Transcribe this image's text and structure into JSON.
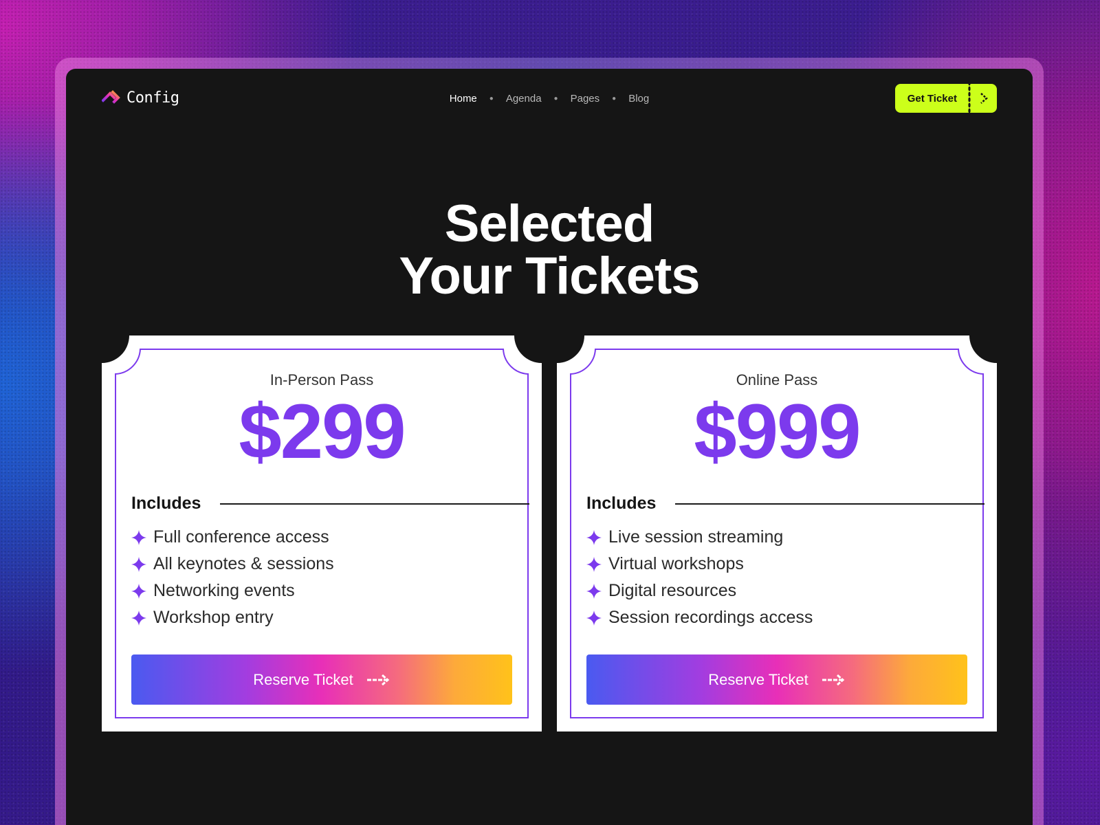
{
  "header": {
    "logo_text": "Config",
    "nav": [
      {
        "label": "Home",
        "active": true
      },
      {
        "label": "Agenda",
        "active": false
      },
      {
        "label": "Pages",
        "active": false
      },
      {
        "label": "Blog",
        "active": false
      }
    ],
    "cta_label": "Get Ticket",
    "cta_icon": "chevron-right-icon"
  },
  "title": {
    "line1": "Selected",
    "line2": "Your Tickets"
  },
  "tickets": [
    {
      "name": "In-Person Pass",
      "price": "$299",
      "includes_label": "Includes",
      "features": [
        "Full conference access",
        "All keynotes & sessions",
        "Networking events",
        "Workshop entry"
      ],
      "button_label": "Reserve Ticket",
      "button_icon": "arrow-right-icon"
    },
    {
      "name": "Online Pass",
      "price": "$999",
      "includes_label": "Includes",
      "features": [
        "Live session streaming",
        "Virtual workshops",
        "Digital resources",
        "Session recordings access"
      ],
      "button_label": "Reserve Ticket",
      "button_icon": "arrow-right-icon"
    }
  ],
  "colors": {
    "accent": "#7c3aed",
    "cta": "#ccff1a",
    "background": "#151515"
  }
}
